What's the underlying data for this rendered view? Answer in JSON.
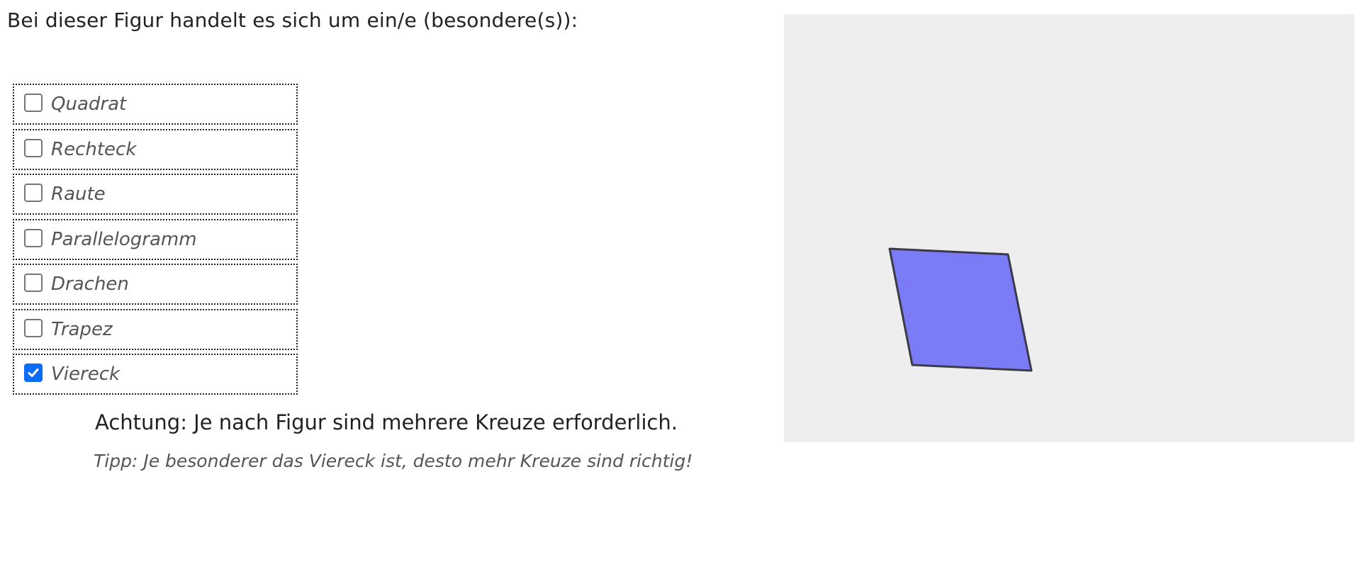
{
  "question": {
    "text": "Bei dieser Figur handelt es sich um ein/e (besondere(s)):"
  },
  "options": [
    {
      "label": "Quadrat",
      "checked": false
    },
    {
      "label": "Rechteck",
      "checked": false
    },
    {
      "label": "Raute",
      "checked": false
    },
    {
      "label": "Parallelogramm",
      "checked": false
    },
    {
      "label": "Drachen",
      "checked": false
    },
    {
      "label": "Trapez",
      "checked": false
    },
    {
      "label": "Viereck",
      "checked": true
    }
  ],
  "warning": {
    "text": "Achtung: Je nach Figur sind mehrere Kreuze erforderlich."
  },
  "tip": {
    "text": "Tipp: Je besonderer das Viereck ist, desto mehr Kreuze sind richtig!"
  },
  "colors": {
    "panel_background": "#eeeeee",
    "shape_fill": "#7b7bf5",
    "shape_stroke": "#3a3a4a",
    "checkbox_checked": "#0b6cf5"
  }
}
